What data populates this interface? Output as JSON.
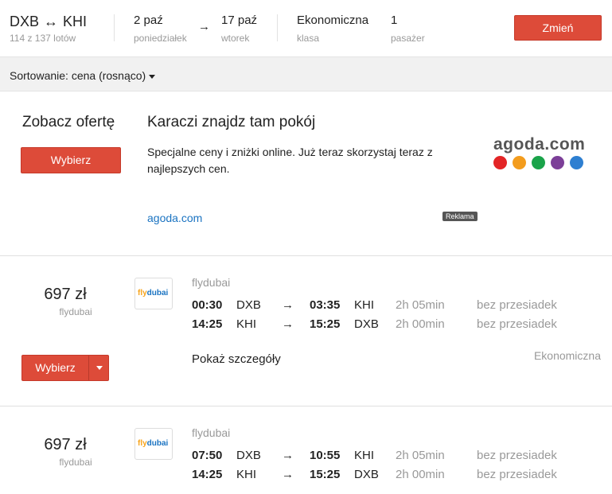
{
  "header": {
    "origin": "DXB",
    "destination": "KHI",
    "flight_count": "114 z 137 lotów",
    "depart_date": "2 paź",
    "depart_day": "poniedziałek",
    "return_date": "17 paź",
    "return_day": "wtorek",
    "cabin": "Ekonomiczna",
    "cabin_label": "klasa",
    "passengers": "1",
    "passengers_label": "pasażer",
    "change_label": "Zmień"
  },
  "sort": {
    "label": "Sortowanie: cena (rosnąco)"
  },
  "ad": {
    "offer_title": "Zobacz ofertę",
    "select_label": "Wybierz",
    "title": "Karaczi znajdz tam pokój",
    "text": "Specjalne ceny i zniżki online. Już teraz skorzystaj teraz z najlepszych cen.",
    "link": "agoda.com",
    "badge": "Reklama",
    "logo_text": "agoda.com",
    "dot_colors": [
      "#e32526",
      "#f39c1d",
      "#1aa34a",
      "#7c3f98",
      "#2e7fd1"
    ]
  },
  "flights": [
    {
      "price": "697 zł",
      "price_airline": "flydubai",
      "logo_fly": "fly",
      "logo_dubai": "dubai",
      "airline": "flydubai",
      "legs": [
        {
          "dep_time": "00:30",
          "from": "DXB",
          "arr_time": "03:35",
          "to": "KHI",
          "duration": "2h 05min",
          "stops": "bez przesiadek"
        },
        {
          "dep_time": "14:25",
          "from": "KHI",
          "arr_time": "15:25",
          "to": "DXB",
          "duration": "2h 00min",
          "stops": "bez przesiadek"
        }
      ],
      "details_label": "Pokaż szczegóły",
      "cabin": "Ekonomiczna",
      "select_label": "Wybierz"
    },
    {
      "price": "697 zł",
      "price_airline": "flydubai",
      "logo_fly": "fly",
      "logo_dubai": "dubai",
      "airline": "flydubai",
      "legs": [
        {
          "dep_time": "07:50",
          "from": "DXB",
          "arr_time": "10:55",
          "to": "KHI",
          "duration": "2h 05min",
          "stops": "bez przesiadek"
        },
        {
          "dep_time": "14:25",
          "from": "KHI",
          "arr_time": "15:25",
          "to": "DXB",
          "duration": "2h 00min",
          "stops": "bez przesiadek"
        }
      ]
    }
  ],
  "icons": {
    "roundtrip": "↔",
    "leg_arrow": "→",
    "date_arrow": "→"
  }
}
